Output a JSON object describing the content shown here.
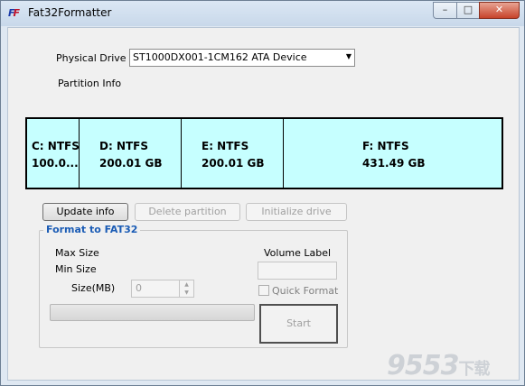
{
  "window": {
    "title": "Fat32Formatter",
    "controls": {
      "minimize": "–",
      "maximize": "□",
      "close": "✕"
    }
  },
  "drive": {
    "physical_drive_label": "Physical Drive",
    "selected": "ST1000DX001-1CM162 ATA Device",
    "partition_info_label": "Partition Info"
  },
  "partitions": [
    {
      "filesystem": "C: NTFS",
      "size": "100.0...",
      "share": 0.108
    },
    {
      "filesystem": "D: NTFS",
      "size": "200.01 GB",
      "share": 0.214
    },
    {
      "filesystem": "E: NTFS",
      "size": "200.01 GB",
      "share": 0.214
    },
    {
      "filesystem": "F: NTFS",
      "size": "431.49 GB",
      "share": 0.464
    }
  ],
  "buttons": {
    "update_info": "Update info",
    "delete_partition": "Delete partition",
    "initialize_drive": "Initialize drive"
  },
  "format_group": {
    "title": "Format to FAT32",
    "max_size_label": "Max Size",
    "min_size_label": "Min Size",
    "size_mb_label": "Size(MB)",
    "size_mb_value": "0",
    "volume_label_label": "Volume Label",
    "quick_format_label": "Quick Format",
    "start_button": "Start",
    "progress": 0
  },
  "watermark": {
    "digits": "9553",
    "suffix": "下载"
  }
}
